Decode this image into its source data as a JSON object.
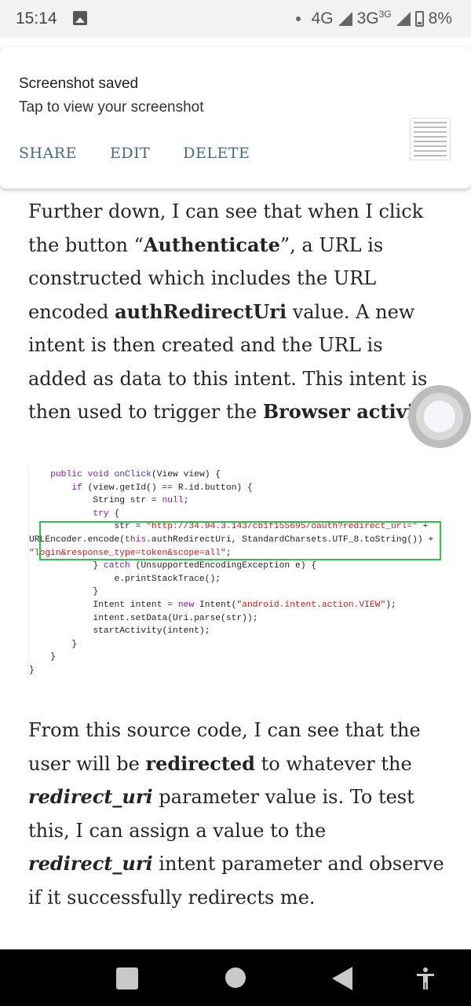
{
  "status_bar": {
    "time": "15:14",
    "network_4g": "4G",
    "network_3g": "3G",
    "network_3g_sup": "3G",
    "battery": "8%"
  },
  "notification": {
    "title": "Screenshot saved",
    "subtitle": "Tap to view your screenshot",
    "actions": [
      "SHARE",
      "EDIT",
      "DELETE"
    ]
  },
  "article": {
    "para1": {
      "t1": "Further down, I can see that when I click the button “",
      "b1": "Authenticate",
      "t2": "”, a URL is constructed which includes the URL encoded ",
      "b2": "authRedirectUri",
      "t3": " value. A new intent is then created and the URL is added as data to this intent. This intent is then used to trigger the ",
      "b3": "Browser activity",
      "t4": "."
    },
    "para2": {
      "t1": "From this source code, I can see that the user will be ",
      "b1": "redirected",
      "t2": " to whatever the ",
      "bi1": "redirect_uri",
      "t3": " parameter value is. To test this, I can assign a value to the ",
      "bi2": "redirect_uri",
      "t4": " intent parameter and observe if it successfully redirects me."
    }
  },
  "code": {
    "l1_a": "    public void ",
    "l1_b": "onClick",
    "l1_c": "(View view) {",
    "l2_a": "        if ",
    "l2_b": "(view.getId() == R.id.button) {",
    "l3_a": "            String str = ",
    "l3_b": "null",
    "l3_c": ";",
    "l4_a": "            try ",
    "l4_b": "{",
    "l5_a": "                str = ",
    "l5_b": "\"http://34.94.3.143/cb1f155695/oauth?redirect_url=\"",
    "l5_c": " +",
    "l6_a": "URLEncoder.encode(",
    "l6_b": "this",
    "l6_c": ".authRedirectUri, StandardCharsets.UTF_8.toString()) +",
    "l7_a": "\"login&response_type=token&scope=all\"",
    "l7_b": ";",
    "l8_a": "            } ",
    "l8_b": "catch",
    "l8_c": " (UnsupportedEncodingException e) {",
    "l9": "                e.printStackTrace();",
    "l10": "            }",
    "l11_a": "            Intent intent = ",
    "l11_b": "new",
    "l11_c": " Intent(",
    "l11_d": "\"android.intent.action.VIEW\"",
    "l11_e": ");",
    "l12": "            intent.setData(Uri.parse(str));",
    "l13": "            startActivity(intent);",
    "l14": "        }",
    "l15": "    }",
    "l16": "}"
  }
}
